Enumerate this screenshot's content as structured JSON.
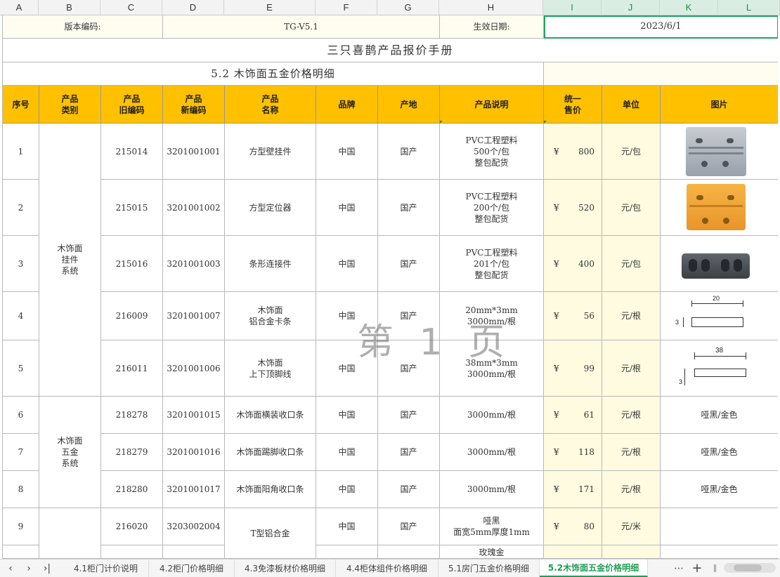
{
  "columns": [
    "A",
    "B",
    "C",
    "D",
    "E",
    "F",
    "G",
    "H",
    "I",
    "J",
    "K",
    "L"
  ],
  "header": {
    "version_label": "版本编码:",
    "version_value": "TG-V5.1",
    "date_label": "生效日期:",
    "date_value": "2023/6/1",
    "title": "三只喜鹊产品报价手册",
    "subtitle": "5.2 木饰面五金价格明细"
  },
  "table_headers": [
    "序号",
    "产品\n类别",
    "产品\n旧编码",
    "产品\n新编码",
    "产品\n名称",
    "品牌",
    "产地",
    "产品说明",
    "统一\n售价",
    "单位",
    "图片"
  ],
  "currency": "¥",
  "categories": {
    "hanging": "木饰面\n挂件\n系统",
    "hardware": "木饰面\n五金\n系统"
  },
  "rows": [
    {
      "no": "1",
      "old": "215014",
      "new": "3201001001",
      "name": "方型壁挂件",
      "brand": "中国",
      "origin": "国产",
      "desc": "PVC工程塑料\n500个/包\n整包配货",
      "price": "800",
      "unit": "元/包",
      "pic": ""
    },
    {
      "no": "2",
      "old": "215015",
      "new": "3201001002",
      "name": "方型定位器",
      "brand": "中国",
      "origin": "国产",
      "desc": "PVC工程塑料\n200个/包\n整包配货",
      "price": "520",
      "unit": "元/包",
      "pic": ""
    },
    {
      "no": "3",
      "old": "215016",
      "new": "3201001003",
      "name": "条形连接件",
      "brand": "中国",
      "origin": "国产",
      "desc": "PVC工程塑料\n201个/包\n整包配货",
      "price": "400",
      "unit": "元/包",
      "pic": ""
    },
    {
      "no": "4",
      "old": "216009",
      "new": "3201001007",
      "name": "木饰面\n铝合金卡条",
      "brand": "中国",
      "origin": "国产",
      "desc": "20mm*3mm\n3000mm/根",
      "price": "56",
      "unit": "元/根",
      "pic": ""
    },
    {
      "no": "5",
      "old": "216011",
      "new": "3201001006",
      "name": "木饰面\n上下顶脚线",
      "brand": "中国",
      "origin": "国产",
      "desc": "38mm*3mm\n3000mm/根",
      "price": "99",
      "unit": "元/根",
      "pic": ""
    },
    {
      "no": "6",
      "old": "218278",
      "new": "3201001015",
      "name": "木饰面横装收口条",
      "brand": "中国",
      "origin": "国产",
      "desc": "3000mm/根",
      "price": "61",
      "unit": "元/根",
      "pic": "哑黑/金色"
    },
    {
      "no": "7",
      "old": "218279",
      "new": "3201001016",
      "name": "木饰面踢脚收口条",
      "brand": "中国",
      "origin": "国产",
      "desc": "3000mm/根",
      "price": "118",
      "unit": "元/根",
      "pic": "哑黑/金色"
    },
    {
      "no": "8",
      "old": "218280",
      "new": "3201001017",
      "name": "木饰面阳角收口条",
      "brand": "中国",
      "origin": "国产",
      "desc": "3000mm/根",
      "price": "171",
      "unit": "元/根",
      "pic": "哑黑/金色"
    },
    {
      "no": "9",
      "old": "216020",
      "new": "3203002004",
      "name": "",
      "brand": "中国",
      "origin": "国产",
      "desc": "哑黑\n面宽5mm厚度1mm",
      "price": "80",
      "unit": "元/米",
      "pic": ""
    }
  ],
  "merged_name_9": "T型铝合金",
  "partial_desc_10": "玫瑰金",
  "drawing_dims": {
    "row4": "20",
    "row4_side": "3",
    "row5": "38",
    "row5_side": "3"
  },
  "watermark": "第 1 页",
  "tabs": [
    "4.1柜门计价说明",
    "4.2柜门价格明细",
    "4.3免漆板材价格明细",
    "4.4柜体组件价格明细",
    "5.1房门五金价格明细",
    "5.2木饰面五金价格明细"
  ],
  "active_tab": "5.2木饰面五金价格明细",
  "icons": {
    "more": "⋯",
    "add": "+"
  }
}
